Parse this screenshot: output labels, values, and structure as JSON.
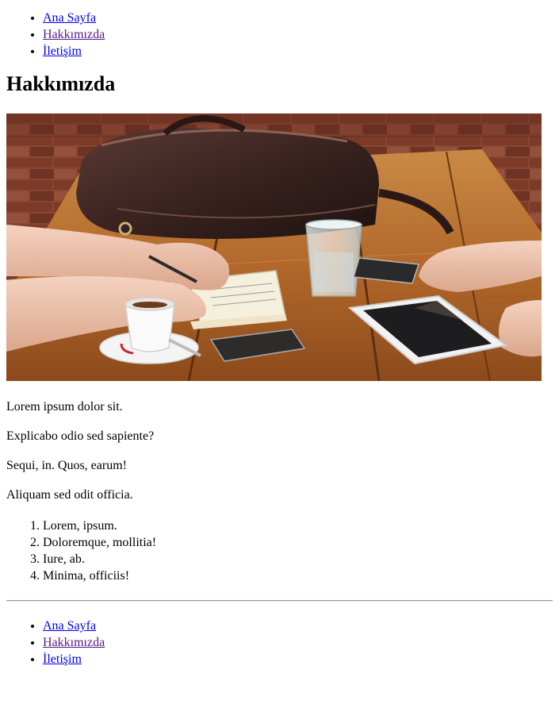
{
  "nav_top": {
    "items": [
      {
        "label": "Ana Sayfa"
      },
      {
        "label": "Hakkımızda"
      },
      {
        "label": "İletişim"
      }
    ]
  },
  "main": {
    "title": "Hakkımızda",
    "image": {
      "subject": "people-working-at-cafe-table",
      "colors": {
        "wood": "#b06a2c",
        "brick": "#7a3b2a",
        "bag": "#3b2522"
      }
    },
    "paragraphs": [
      "Lorem ipsum dolor sit.",
      "Explicabo odio sed sapiente?",
      "Sequi, in. Quos, earum!",
      "Aliquam sed odit officia."
    ],
    "list": [
      "Lorem, ipsum.",
      "Doloremque, mollitia!",
      "Iure, ab.",
      "Minima, officiis!"
    ]
  },
  "nav_bottom": {
    "items": [
      {
        "label": "Ana Sayfa"
      },
      {
        "label": "Hakkımızda"
      },
      {
        "label": "İletişim"
      }
    ]
  },
  "colors": {
    "link": "#0000ee",
    "link_visited": "#551a8b",
    "text": "#000000",
    "background": "#ffffff"
  }
}
